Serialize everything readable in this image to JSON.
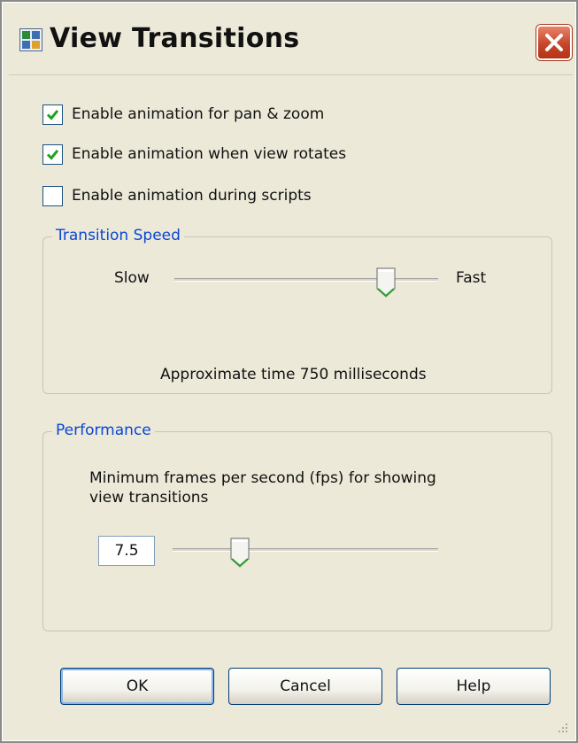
{
  "window": {
    "title": "View Transitions",
    "app_icon": "app-icon",
    "close_icon": "close-icon"
  },
  "checkboxes": [
    {
      "label": "Enable animation for pan & zoom",
      "checked": true
    },
    {
      "label": "Enable animation when view rotates",
      "checked": true
    },
    {
      "label": "Enable animation during scripts",
      "checked": false
    }
  ],
  "transition_speed": {
    "group_label": "Transition Speed",
    "slow_label": "Slow",
    "fast_label": "Fast",
    "slider_level": 0.8,
    "approx_text": "Approximate time  750 milliseconds"
  },
  "performance": {
    "group_label": "Performance",
    "description_line1": "Minimum frames per second (fps) for showing",
    "description_line2": "view transitions",
    "fps_value": "7.5",
    "slider_level": 0.25
  },
  "buttons": {
    "ok": "OK",
    "cancel": "Cancel",
    "help": "Help"
  },
  "colors": {
    "accent_blue": "#0a46d6",
    "check_green": "#21a121",
    "close_red": "#c6462a",
    "thumb_green": "#2ca02c"
  }
}
